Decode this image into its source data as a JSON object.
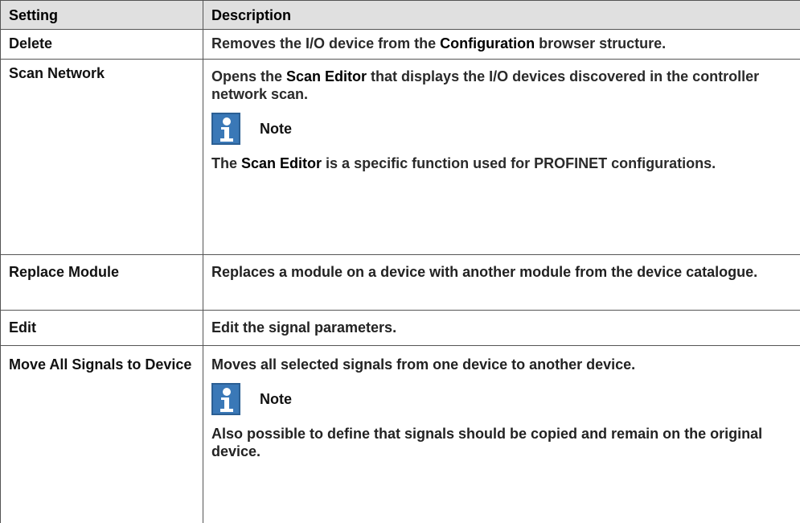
{
  "header": {
    "col1": "Setting",
    "col2": "Description"
  },
  "rows": [
    {
      "setting": "Delete",
      "desc_pre": "Removes the I/O device from the ",
      "desc_bold": "Configuration",
      "desc_post": " browser structure."
    },
    {
      "setting": "Scan Network",
      "desc_pre": "Opens the ",
      "desc_bold": "Scan Editor",
      "desc_post": " that displays the I/O devices discovered in the controller network scan.",
      "note_label": "Note",
      "note_pre": "The ",
      "note_bold": "Scan Editor",
      "note_post": " is a specific function used for PROFINET configurations."
    },
    {
      "setting": "Replace Module",
      "desc": "Replaces a module on a device with another module from the device catalogue."
    },
    {
      "setting": "Edit",
      "desc": "Edit the signal parameters."
    },
    {
      "setting": "Move All Signals to Device",
      "desc": "Moves all selected signals from one device to another device.",
      "note_label": "Note",
      "note_text": "Also possible to define that signals should be copied and remain on the original device."
    }
  ]
}
